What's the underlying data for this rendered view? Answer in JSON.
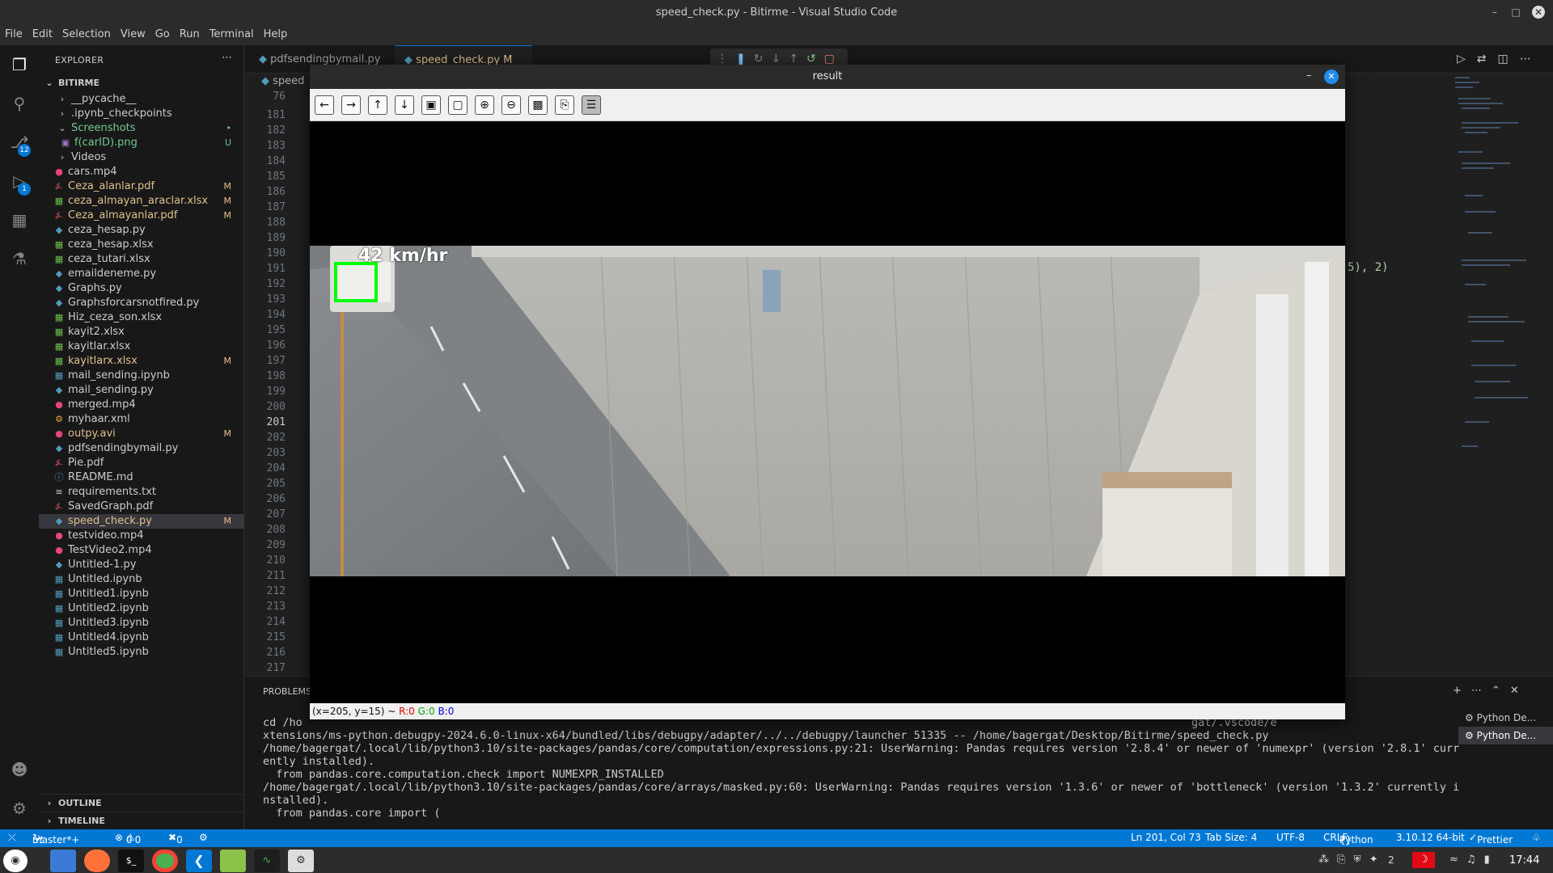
{
  "window": {
    "title": "speed_check.py - Bitirme - Visual Studio Code"
  },
  "menu": [
    "File",
    "Edit",
    "Selection",
    "View",
    "Go",
    "Run",
    "Terminal",
    "Help"
  ],
  "activity": {
    "scm_badge": "12",
    "debug_badge": "1"
  },
  "explorer": {
    "header": "EXPLORER",
    "root": "BITIRME",
    "items": [
      {
        "label": "__pycache__",
        "kind": "folder",
        "status": ""
      },
      {
        "label": ".ipynb_checkpoints",
        "kind": "folder",
        "status": ""
      },
      {
        "label": "Screenshots",
        "kind": "folder-open",
        "status": "•"
      },
      {
        "label": "f(carID).png",
        "kind": "image",
        "status": "U"
      },
      {
        "label": "Videos",
        "kind": "folder",
        "status": ""
      },
      {
        "label": "cars.mp4",
        "kind": "video",
        "status": ""
      },
      {
        "label": "Ceza_alanlar.pdf",
        "kind": "pdf",
        "status": "M"
      },
      {
        "label": "ceza_almayan_araclar.xlsx",
        "kind": "xlsx",
        "status": "M"
      },
      {
        "label": "Ceza_almayanlar.pdf",
        "kind": "pdf",
        "status": "M"
      },
      {
        "label": "ceza_hesap.py",
        "kind": "py",
        "status": ""
      },
      {
        "label": "ceza_hesap.xlsx",
        "kind": "xlsx",
        "status": ""
      },
      {
        "label": "ceza_tutari.xlsx",
        "kind": "xlsx",
        "status": ""
      },
      {
        "label": "emaildeneme.py",
        "kind": "py",
        "status": ""
      },
      {
        "label": "Graphs.py",
        "kind": "py",
        "status": ""
      },
      {
        "label": "Graphsforcarsnotfired.py",
        "kind": "py",
        "status": ""
      },
      {
        "label": "Hiz_ceza_son.xlsx",
        "kind": "xlsx",
        "status": ""
      },
      {
        "label": "kayit2.xlsx",
        "kind": "xlsx",
        "status": ""
      },
      {
        "label": "kayitlar.xlsx",
        "kind": "xlsx",
        "status": ""
      },
      {
        "label": "kayitlarx.xlsx",
        "kind": "xlsx",
        "status": "M"
      },
      {
        "label": "mail_sending.ipynb",
        "kind": "ipynb",
        "status": ""
      },
      {
        "label": "mail_sending.py",
        "kind": "py",
        "status": ""
      },
      {
        "label": "merged.mp4",
        "kind": "video",
        "status": ""
      },
      {
        "label": "myhaar.xml",
        "kind": "xml",
        "status": ""
      },
      {
        "label": "outpy.avi",
        "kind": "video",
        "status": "M"
      },
      {
        "label": "pdfsendingbymail.py",
        "kind": "py",
        "status": ""
      },
      {
        "label": "Pie.pdf",
        "kind": "pdf",
        "status": ""
      },
      {
        "label": "README.md",
        "kind": "md",
        "status": ""
      },
      {
        "label": "requirements.txt",
        "kind": "txt",
        "status": ""
      },
      {
        "label": "SavedGraph.pdf",
        "kind": "pdf",
        "status": ""
      },
      {
        "label": "speed_check.py",
        "kind": "py",
        "status": "M"
      },
      {
        "label": "testvideo.mp4",
        "kind": "video",
        "status": ""
      },
      {
        "label": "TestVideo2.mp4",
        "kind": "video",
        "status": ""
      },
      {
        "label": "Untitled-1.py",
        "kind": "py",
        "status": ""
      },
      {
        "label": "Untitled.ipynb",
        "kind": "ipynb",
        "status": ""
      },
      {
        "label": "Untitled1.ipynb",
        "kind": "ipynb",
        "status": ""
      },
      {
        "label": "Untitled2.ipynb",
        "kind": "ipynb",
        "status": ""
      },
      {
        "label": "Untitled3.ipynb",
        "kind": "ipynb",
        "status": ""
      },
      {
        "label": "Untitled4.ipynb",
        "kind": "ipynb",
        "status": ""
      },
      {
        "label": "Untitled5.ipynb",
        "kind": "ipynb",
        "status": ""
      }
    ],
    "outline": "OUTLINE",
    "timeline": "TIMELINE"
  },
  "tabs": [
    {
      "label": "pdfsendingbymail.py",
      "active": false
    },
    {
      "label": "speed_check.py M",
      "active": true
    }
  ],
  "breadcrumb": "speed",
  "editor": {
    "first_line": "76",
    "line_numbers": [
      "181",
      "182",
      "183",
      "184",
      "185",
      "186",
      "187",
      "188",
      "189",
      "190",
      "191",
      "192",
      "193",
      "194",
      "195",
      "196",
      "197",
      "198",
      "199",
      "200",
      "201",
      "202",
      "203",
      "204",
      "205",
      "206",
      "207",
      "208",
      "209",
      "210",
      "211",
      "212",
      "213",
      "214",
      "215",
      "216",
      "217"
    ],
    "current_line": "201",
    "visible_code_fragment": "5), 2)"
  },
  "panel": {
    "tab": "PROBLEMS",
    "terminal_lines": [
      "cd /ho",
      "xtensions/ms-python.debugpy-2024.6.0-linux-x64/bundled/libs/debugpy/adapter/../../debugpy/launcher 51335 -- /home/bagergat/Desktop/Bitirme/speed_check.py",
      "/home/bagergat/.local/lib/python3.10/site-packages/pandas/core/computation/expressions.py:21: UserWarning: Pandas requires version '2.8.4' or newer of 'numexpr' (version '2.8.1' curr",
      "ently installed).",
      "  from pandas.core.computation.check import NUMEXPR_INSTALLED",
      "/home/bagergat/.local/lib/python3.10/site-packages/pandas/core/arrays/masked.py:60: UserWarning: Pandas requires version '1.3.6' or newer of 'bottleneck' (version '1.3.2' currently i",
      "nstalled).",
      "  from pandas.core import ("
    ],
    "first_line_tail": "gat/.vscode/e",
    "sessions": [
      "Python De...",
      "Python De..."
    ]
  },
  "status": {
    "branch": "master*+",
    "errors": "0",
    "warnings": "0",
    "ports": "0",
    "position": "Ln 201, Col 73",
    "tab_size": "Tab Size: 4",
    "encoding": "UTF-8",
    "eol": "CRLF",
    "language": "Python",
    "interpreter": "3.10.12 64-bit",
    "prettier": "Prettier"
  },
  "taskbar": {
    "clock": "17:44",
    "notif_count": "2"
  },
  "cv_window": {
    "title": "result",
    "speed_label": "42 km/hr",
    "status_prefix": "(x=205, y=15) ~ ",
    "r": "R:0",
    "g": "G:0",
    "b": "B:0",
    "toolbar_icons": [
      "arrow-left-icon",
      "arrow-right-icon",
      "arrow-up-icon",
      "arrow-down-icon",
      "zoom-fit-icon",
      "zoom-original-icon",
      "zoom-in-icon",
      "zoom-out-icon",
      "save-icon",
      "copy-icon",
      "properties-icon"
    ]
  },
  "colors": {
    "accent": "#0078d4",
    "modified": "#e2c08d",
    "untracked": "#73c991",
    "bbox": "#00ff00"
  }
}
